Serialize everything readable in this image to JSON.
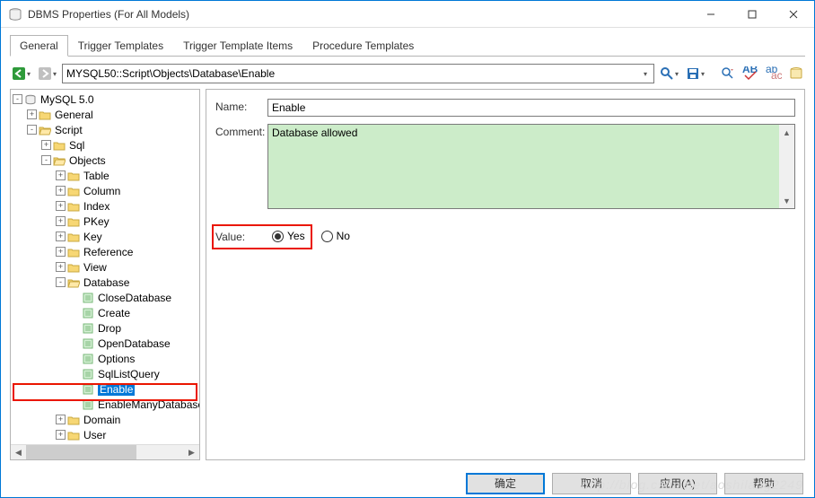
{
  "title": "DBMS Properties (For All Models)",
  "tabs": [
    "General",
    "Trigger Templates",
    "Trigger Template Items",
    "Procedure Templates"
  ],
  "activeTab": 0,
  "address": "MYSQL50::Script\\Objects\\Database\\Enable",
  "tree": {
    "root": "MySQL 5.0",
    "nodes": [
      {
        "depth": 0,
        "exp": "-",
        "icon": "db",
        "label": "MySQL 5.0"
      },
      {
        "depth": 1,
        "exp": "+",
        "icon": "folder",
        "label": "General"
      },
      {
        "depth": 1,
        "exp": "-",
        "icon": "folder-open",
        "label": "Script"
      },
      {
        "depth": 2,
        "exp": "+",
        "icon": "folder",
        "label": "Sql"
      },
      {
        "depth": 2,
        "exp": "-",
        "icon": "folder-open",
        "label": "Objects"
      },
      {
        "depth": 3,
        "exp": "+",
        "icon": "folder",
        "label": "Table"
      },
      {
        "depth": 3,
        "exp": "+",
        "icon": "folder",
        "label": "Column"
      },
      {
        "depth": 3,
        "exp": "+",
        "icon": "folder",
        "label": "Index"
      },
      {
        "depth": 3,
        "exp": "+",
        "icon": "folder",
        "label": "PKey"
      },
      {
        "depth": 3,
        "exp": "+",
        "icon": "folder",
        "label": "Key"
      },
      {
        "depth": 3,
        "exp": "+",
        "icon": "folder",
        "label": "Reference"
      },
      {
        "depth": 3,
        "exp": "+",
        "icon": "folder",
        "label": "View"
      },
      {
        "depth": 3,
        "exp": "-",
        "icon": "folder-open",
        "label": "Database"
      },
      {
        "depth": 4,
        "exp": "",
        "icon": "item",
        "label": "CloseDatabase"
      },
      {
        "depth": 4,
        "exp": "",
        "icon": "item",
        "label": "Create"
      },
      {
        "depth": 4,
        "exp": "",
        "icon": "item",
        "label": "Drop"
      },
      {
        "depth": 4,
        "exp": "",
        "icon": "item",
        "label": "OpenDatabase"
      },
      {
        "depth": 4,
        "exp": "",
        "icon": "item",
        "label": "Options"
      },
      {
        "depth": 4,
        "exp": "",
        "icon": "item",
        "label": "SqlListQuery"
      },
      {
        "depth": 4,
        "exp": "",
        "icon": "item",
        "label": "Enable",
        "sel": true
      },
      {
        "depth": 4,
        "exp": "",
        "icon": "item",
        "label": "EnableManyDatabases"
      },
      {
        "depth": 3,
        "exp": "+",
        "icon": "folder",
        "label": "Domain"
      },
      {
        "depth": 3,
        "exp": "+",
        "icon": "folder",
        "label": "User"
      }
    ]
  },
  "form": {
    "nameLabel": "Name:",
    "nameValue": "Enable",
    "commentLabel": "Comment:",
    "commentValue": "Database allowed",
    "valueLabel": "Value:",
    "yesLabel": "Yes",
    "noLabel": "No",
    "selected": "yes"
  },
  "buttons": {
    "ok": "确定",
    "cancel": "取消",
    "apply": "应用(A)",
    "help": "帮助"
  },
  "watermark": "http://blog.csdn.net/aoshilang2249"
}
